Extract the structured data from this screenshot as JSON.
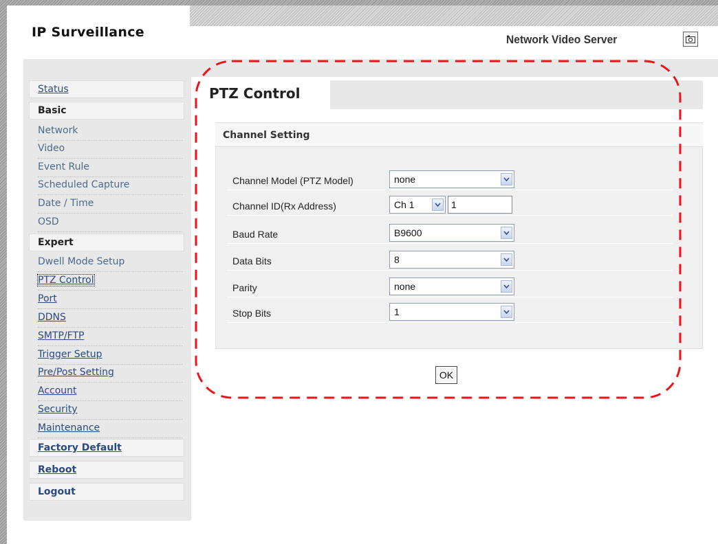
{
  "app": {
    "logo": "IP Surveillance",
    "product": "Network Video Server",
    "snapshot_icon": "camera-icon"
  },
  "page": {
    "title": "PTZ Control"
  },
  "sidebar": {
    "status": "Status",
    "basic": {
      "heading": "Basic",
      "items": [
        "Network",
        "Video",
        "Event Rule",
        "Scheduled Capture",
        "Date / Time",
        "OSD"
      ]
    },
    "expert": {
      "heading": "Expert",
      "items": [
        "Dwell Mode Setup",
        "PTZ Control",
        "Port",
        "DDNS",
        "SMTP/FTP",
        "Trigger Setup",
        "Pre/Post Setting",
        "Account",
        "Security",
        "Maintenance"
      ]
    },
    "factory_default": "Factory Default",
    "reboot": "Reboot",
    "logout": "Logout"
  },
  "channel_setting": {
    "heading": "Channel Setting",
    "rows": [
      {
        "label": "Channel Model (PTZ Model)",
        "value": "none"
      },
      {
        "label": "Channel ID(Rx Address)",
        "channel": "Ch 1",
        "address": "1"
      },
      {
        "label": "Baud Rate",
        "value": "B9600"
      },
      {
        "label": "Data Bits",
        "value": "8"
      },
      {
        "label": "Parity",
        "value": "none"
      },
      {
        "label": "Stop Bits",
        "value": "1"
      }
    ]
  },
  "actions": {
    "ok": "OK"
  },
  "colors": {
    "annotation": "#e8141c",
    "link": "#2a4a80",
    "panel": "#e8e8e8"
  }
}
